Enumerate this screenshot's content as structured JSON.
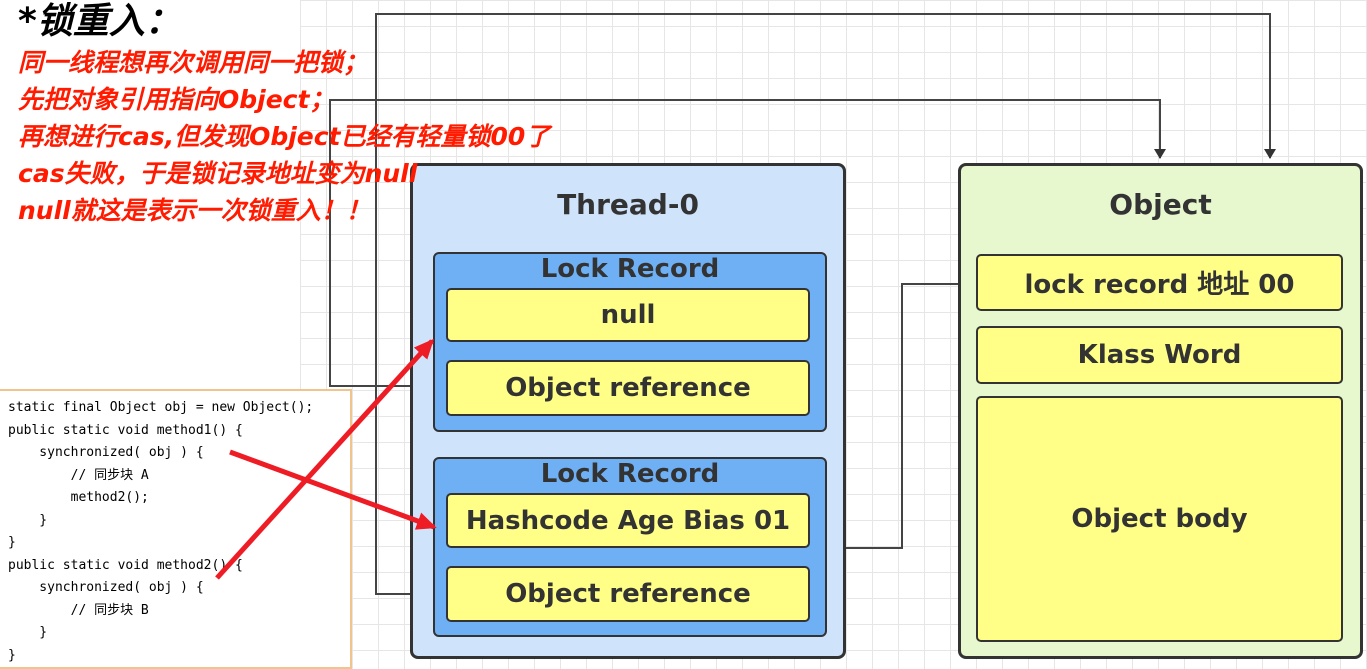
{
  "notes": {
    "heading": "*锁重入：",
    "lines": [
      "同一线程想再次调用同一把锁；",
      "先把对象引用指向Object；",
      "再想进行cas,但发现Object已经有轻量锁00了",
      "cas失败，于是锁记录地址变为null",
      "null就这是表示一次锁重入！！"
    ]
  },
  "thread": {
    "title": "Thread-0",
    "records": [
      {
        "title": "Lock Record",
        "top": "null",
        "bottom": "Object reference"
      },
      {
        "title": "Lock Record",
        "top": "Hashcode Age Bias 01",
        "bottom": "Object reference"
      }
    ]
  },
  "object": {
    "title": "Object",
    "header": "lock record 地址 00",
    "klass": "Klass Word",
    "body": "Object body"
  },
  "code": {
    "lines": [
      "static final Object obj = new Object();",
      "public static void method1() {",
      "    synchronized( obj ) {",
      "        // 同步块 A",
      "        method2();",
      "    }",
      "}",
      "public static void method2() {",
      "    synchronized( obj ) {",
      "        // 同步块 B",
      "    }",
      "}"
    ]
  },
  "colors": {
    "thread_fill": "#cfe3fb",
    "lock_record_fill": "#6fb0f5",
    "cell_fill": "#ffff88",
    "object_fill": "#e7f8cf",
    "note_text": "#ff1a00",
    "annotation_arrow": "#ee1c24"
  }
}
